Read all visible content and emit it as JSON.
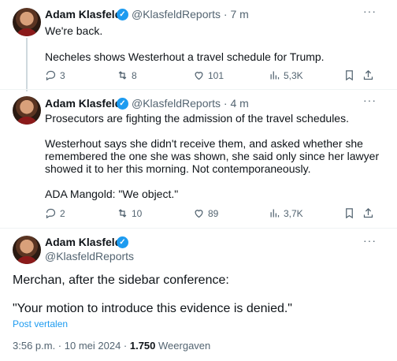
{
  "tweets": [
    {
      "name": "Adam Klasfeld",
      "handle": "@KlasfeldReports · 7 m",
      "lines": [
        "We're back.",
        "",
        "Necheles shows Westerhout a travel schedule for Trump."
      ],
      "replies": "3",
      "reposts": "8",
      "likes": "101",
      "views": "5,3K"
    },
    {
      "name": "Adam Klasfeld",
      "handle": "@KlasfeldReports · 4 m",
      "lines": [
        "Prosecutors are fighting the admission of the travel schedules.",
        "",
        "Westerhout says she didn't receive them, and asked whether she",
        "remembered the one she was shown, she said only since her lawyer",
        "showed it to her this morning. Not contemporaneously.",
        "",
        "ADA Mangold: \"We object.\""
      ],
      "replies": "2",
      "reposts": "10",
      "likes": "89",
      "views": "3,7K"
    }
  ],
  "main": {
    "name": "Adam Klasfeld",
    "handle": "@KlasfeldReports",
    "line1": "Merchan, after the sidebar conference:",
    "line2": "\"Your motion to introduce this evidence is denied.\"",
    "translate": "Post vertalen",
    "time": "3:56 p.m. · 10 mei 2024 · ",
    "views_count": "1.750",
    "views_label": " Weergaven"
  },
  "icons": {
    "more": "more-icon",
    "reply": "reply-icon",
    "repost": "repost-icon",
    "like": "like-icon",
    "views": "views-icon",
    "bookmark": "bookmark-icon",
    "share": "share-icon"
  },
  "colors": {
    "accent": "#1d9bf0",
    "muted": "#536471",
    "text": "#0f1419"
  }
}
